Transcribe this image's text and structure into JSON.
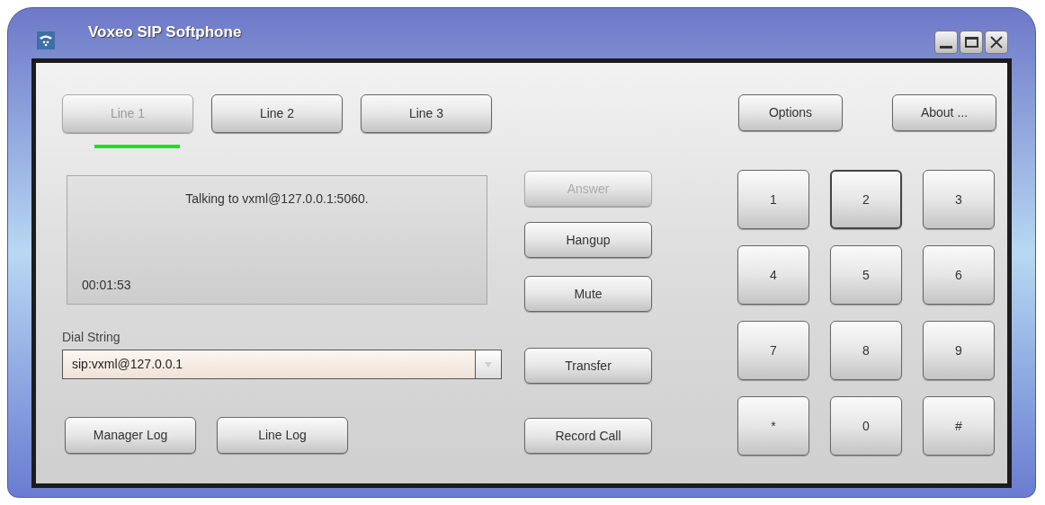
{
  "window": {
    "title": "Voxeo SIP Softphone"
  },
  "line_tabs": [
    {
      "label": "Line 1",
      "selected": true
    },
    {
      "label": "Line 2",
      "selected": false
    },
    {
      "label": "Line 3",
      "selected": false
    }
  ],
  "top_buttons": [
    "Options",
    "About ..."
  ],
  "status": {
    "message": "Talking to vxml@127.0.0.1:5060.",
    "timer": "00:01:53"
  },
  "dial_string": {
    "label": "Dial String",
    "value": "sip:vxml@127.0.0.1"
  },
  "log_buttons": [
    "Manager Log",
    "Line Log"
  ],
  "call_buttons": [
    {
      "label": "Answer",
      "disabled": true
    },
    {
      "label": "Hangup",
      "disabled": false
    },
    {
      "label": "Mute",
      "disabled": false
    },
    {
      "label": "Transfer",
      "disabled": false
    },
    {
      "label": "Record Call",
      "disabled": false
    }
  ],
  "keypad": [
    {
      "label": "1",
      "focused": false
    },
    {
      "label": "2",
      "focused": true
    },
    {
      "label": "3",
      "focused": false
    },
    {
      "label": "4",
      "focused": false
    },
    {
      "label": "5",
      "focused": false
    },
    {
      "label": "6",
      "focused": false
    },
    {
      "label": "7",
      "focused": false
    },
    {
      "label": "8",
      "focused": false
    },
    {
      "label": "9",
      "focused": false
    },
    {
      "label": "*",
      "focused": false
    },
    {
      "label": "0",
      "focused": false
    },
    {
      "label": "#",
      "focused": false
    }
  ]
}
